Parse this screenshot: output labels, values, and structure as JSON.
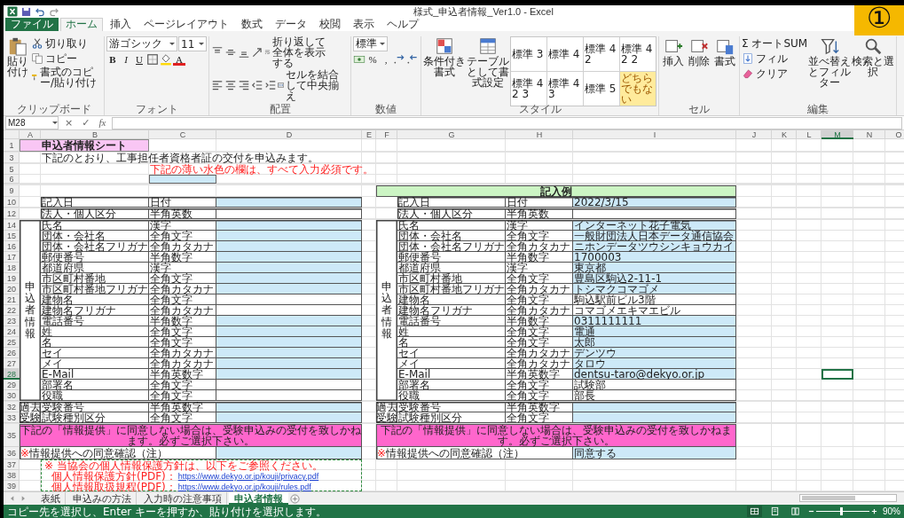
{
  "window": {
    "title": "様式_申込者情報_Ver1.0 - Excel",
    "badge": "①"
  },
  "ribbon": {
    "tabs": [
      {
        "label": "ファイル",
        "kind": "file",
        "selected": false
      },
      {
        "label": "ホーム",
        "kind": "tab",
        "selected": true
      },
      {
        "label": "挿入",
        "kind": "tab",
        "selected": false
      },
      {
        "label": "ページレイアウト",
        "kind": "tab",
        "selected": false
      },
      {
        "label": "数式",
        "kind": "tab",
        "selected": false
      },
      {
        "label": "データ",
        "kind": "tab",
        "selected": false
      },
      {
        "label": "校閲",
        "kind": "tab",
        "selected": false
      },
      {
        "label": "表示",
        "kind": "tab",
        "selected": false
      },
      {
        "label": "ヘルプ",
        "kind": "tab",
        "selected": false
      }
    ],
    "groups": [
      {
        "name": "クリップボード",
        "large": [
          {
            "kind": "paste",
            "label": "貼り付け"
          }
        ],
        "rows": [
          {
            "items": [
              {
                "kind": "cut",
                "label": "切り取り"
              }
            ]
          },
          {
            "items": [
              {
                "kind": "copy",
                "label": "コピー"
              }
            ]
          },
          {
            "items": [
              {
                "kind": "format-painter",
                "label": "書式のコピー/貼り付け"
              }
            ]
          }
        ]
      },
      {
        "name": "フォント",
        "rows": [
          {
            "items": [
              {
                "kind": "dropdown",
                "value": "游ゴシック"
              },
              {
                "kind": "dropdown",
                "value": "11"
              }
            ]
          },
          {
            "items": [
              {
                "kind": "bold",
                "label": "B"
              },
              {
                "kind": "italic",
                "label": "I"
              },
              {
                "kind": "underline",
                "label": "U"
              },
              {
                "kind": "borders"
              },
              {
                "kind": "fill-color"
              },
              {
                "kind": "font-color",
                "label": "A"
              }
            ]
          }
        ]
      },
      {
        "name": "配置",
        "rows": [
          {
            "items": [
              {
                "kind": "align-top"
              },
              {
                "kind": "align-middle"
              },
              {
                "kind": "align-bottom"
              },
              {
                "kind": "orientation"
              },
              {
                "kind": "wrap-text",
                "label": "折り返して全体を表示する"
              }
            ]
          },
          {
            "items": [
              {
                "kind": "align-left"
              },
              {
                "kind": "align-center"
              },
              {
                "kind": "align-right"
              },
              {
                "kind": "decrease-indent"
              },
              {
                "kind": "increase-indent"
              },
              {
                "kind": "merge-center",
                "label": "セルを結合して中央揃え"
              }
            ]
          }
        ]
      },
      {
        "name": "数値",
        "rows": [
          {
            "items": [
              {
                "kind": "dropdown",
                "value": "標準"
              }
            ]
          },
          {
            "items": [
              {
                "kind": "currency"
              },
              {
                "kind": "percent",
                "label": "%"
              },
              {
                "kind": "comma",
                "label": ","
              },
              {
                "kind": "increase-decimal"
              },
              {
                "kind": "decrease-decimal"
              }
            ]
          }
        ]
      },
      {
        "name": "スタイル",
        "large": [
          {
            "kind": "conditional-format",
            "label": "条件付き書式"
          },
          {
            "kind": "format-as-table",
            "label": "テーブルとして書式設定"
          }
        ],
        "gallery": [
          {
            "label": "標準 3",
            "kind": "normal"
          },
          {
            "label": "標準 4",
            "kind": "normal"
          },
          {
            "label": "標準 4 2",
            "kind": "normal"
          },
          {
            "label": "標準 4 2 2",
            "kind": "normal"
          },
          {
            "label": "標準 4 2 3",
            "kind": "normal"
          },
          {
            "label": "標準 4 3",
            "kind": "normal"
          },
          {
            "label": "標準 5",
            "kind": "normal"
          },
          {
            "label": "どちらでもない",
            "kind": "neutral"
          }
        ]
      },
      {
        "name": "セル",
        "large": [
          {
            "kind": "insert",
            "label": "挿入"
          },
          {
            "kind": "delete",
            "label": "削除"
          },
          {
            "kind": "format",
            "label": "書式"
          }
        ]
      },
      {
        "name": "編集",
        "rows": [
          {
            "items": [
              {
                "kind": "autosum",
                "label": "Σ オートSUM"
              }
            ]
          },
          {
            "items": [
              {
                "kind": "fill",
                "label": "フィル"
              }
            ]
          },
          {
            "items": [
              {
                "kind": "clear",
                "label": "クリア"
              }
            ]
          }
        ],
        "large": [
          {
            "kind": "sort-filter",
            "label": "並べ替えとフィルター"
          },
          {
            "kind": "find-select",
            "label": "検索と選択"
          }
        ]
      }
    ]
  },
  "formula_bar": {
    "name_box": "M28",
    "cancel": "×",
    "enter": "✓",
    "function": "fx"
  },
  "sheet": {
    "columns": [
      {
        "label": "A",
        "selected": false
      },
      {
        "label": "B",
        "selected": false
      },
      {
        "label": "C",
        "selected": false
      },
      {
        "label": "D",
        "selected": false
      },
      {
        "label": "E",
        "selected": false
      },
      {
        "label": "F",
        "selected": false
      },
      {
        "label": "G",
        "selected": false
      },
      {
        "label": "H",
        "selected": false
      },
      {
        "label": "I",
        "selected": false
      },
      {
        "label": "J",
        "selected": false
      },
      {
        "label": "K",
        "selected": false
      },
      {
        "label": "L",
        "selected": false
      },
      {
        "label": "M",
        "selected": true
      },
      {
        "label": "N",
        "selected": false
      },
      {
        "label": "O",
        "selected": false
      }
    ],
    "rows": [
      {
        "kind": "title",
        "number": "1",
        "selected": false,
        "text": "申込者情報シート"
      },
      {
        "kind": "blank"
      },
      {
        "kind": "intro",
        "number": "3",
        "selected": false,
        "text": "下記のとおり、工事担任者資格者証の交付を申込みます。"
      },
      {
        "kind": "blank"
      },
      {
        "kind": "warning",
        "number": "5",
        "selected": false,
        "text": "下記の薄い水色の欄は、すべて入力必須です。"
      },
      {
        "kind": "legend",
        "number": "6",
        "selected": false
      },
      {
        "kind": "blank"
      },
      {
        "kind": "blank"
      },
      {
        "kind": "example_header",
        "number": "9",
        "selected": false,
        "example_title": "記入例"
      },
      {
        "kind": "section",
        "rows": [
          {
            "number": "10",
            "selected": false,
            "left": {
              "label": "記入日",
              "type": "日付",
              "required": true
            },
            "right": {
              "label": "記入日",
              "type": "日付",
              "value": "2022/3/15",
              "required": true
            }
          }
        ]
      },
      {
        "kind": "blank"
      },
      {
        "kind": "section",
        "rows": [
          {
            "number": "12",
            "selected": false,
            "left": {
              "label": "法人・個人区分",
              "type": "半角英数",
              "required": false
            },
            "right": {
              "label": "法人・個人区分",
              "type": "半角英数",
              "required": false
            }
          }
        ]
      },
      {
        "kind": "blank"
      },
      {
        "kind": "section",
        "side_left": "申込者情報",
        "side_right": "申込者情報",
        "rows": [
          {
            "number": "14",
            "selected": false,
            "left": {
              "label": "氏名",
              "type": "漢字",
              "required": true
            },
            "right": {
              "label": "氏名",
              "type": "漢字",
              "value": "インターネット花子電気",
              "required": true
            }
          },
          {
            "number": "15",
            "selected": false,
            "left": {
              "label": "団体・会社名",
              "type": "全角文字",
              "required": true
            },
            "right": {
              "label": "団体・会社名",
              "type": "全角文字",
              "value": "一般財団法人日本データ通信協会",
              "required": true
            }
          },
          {
            "number": "16",
            "selected": false,
            "left": {
              "label": "団体・会社名フリガナ",
              "type": "全角カタカナ",
              "required": true
            },
            "right": {
              "label": "団体・会社名フリガナ",
              "type": "全角カタカナ",
              "value": "ニホンデータツウシンキョウカイ",
              "required": true
            }
          },
          {
            "number": "17",
            "selected": false,
            "left": {
              "label": "郵便番号",
              "type": "半角数字",
              "required": true
            },
            "right": {
              "label": "郵便番号",
              "type": "半角数字",
              "value": "1700003",
              "required": true
            }
          },
          {
            "number": "18",
            "selected": false,
            "left": {
              "label": "都道府県",
              "type": "漢字",
              "required": true
            },
            "right": {
              "label": "都道府県",
              "type": "漢字",
              "value": "東京都",
              "required": true
            }
          },
          {
            "number": "19",
            "selected": false,
            "left": {
              "label": "市区町村番地",
              "type": "全角文字",
              "required": true
            },
            "right": {
              "label": "市区町村番地",
              "type": "全角文字",
              "value": "豊島区駒込2-11-1",
              "required": true
            }
          },
          {
            "number": "20",
            "selected": false,
            "left": {
              "label": "市区町村番地フリガナ",
              "type": "全角カタカナ",
              "required": true
            },
            "right": {
              "label": "市区町村番地フリガナ",
              "type": "全角カタカナ",
              "value": "トシマクコマゴメ",
              "required": true
            }
          },
          {
            "number": "21",
            "selected": false,
            "left": {
              "label": "建物名",
              "type": "全角文字",
              "required": false
            },
            "right": {
              "label": "建物名",
              "type": "全角文字",
              "value": "駒込駅前ビル3階",
              "required": false
            }
          },
          {
            "number": "22",
            "selected": false,
            "left": {
              "label": "建物名フリガナ",
              "type": "全角カタカナ",
              "required": false
            },
            "right": {
              "label": "建物名フリガナ",
              "type": "全角カタカナ",
              "value": "コマゴメエキマエビル",
              "required": false
            }
          },
          {
            "number": "23",
            "selected": false,
            "left": {
              "label": "電話番号",
              "type": "半角数字",
              "required": true
            },
            "right": {
              "label": "電話番号",
              "type": "半角数字",
              "value": "0311111111",
              "required": true
            }
          },
          {
            "number": "24",
            "selected": false,
            "left": {
              "label": "姓",
              "type": "全角文字",
              "required": true
            },
            "right": {
              "label": "姓",
              "type": "全角文字",
              "value": "電通",
              "required": true
            }
          },
          {
            "number": "25",
            "selected": false,
            "left": {
              "label": "名",
              "type": "全角文字",
              "required": true
            },
            "right": {
              "label": "名",
              "type": "全角文字",
              "value": "太郎",
              "required": true
            }
          },
          {
            "number": "26",
            "selected": false,
            "left": {
              "label": "セイ",
              "type": "全角カタカナ",
              "required": true
            },
            "right": {
              "label": "セイ",
              "type": "全角カタカナ",
              "value": "デンツウ",
              "required": true
            }
          },
          {
            "number": "27",
            "selected": false,
            "left": {
              "label": "メイ",
              "type": "全角カタカナ",
              "required": true
            },
            "right": {
              "label": "メイ",
              "type": "全角カタカナ",
              "value": "タロウ",
              "required": true
            }
          },
          {
            "number": "28",
            "selected": true,
            "left": {
              "label": "E-Mail",
              "type": "半角英数字",
              "required": true
            },
            "right": {
              "label": "E-Mail",
              "type": "半角英数字",
              "value": "dentsu-taro@dekyo.or.jp",
              "required": true
            }
          },
          {
            "number": "29",
            "selected": false,
            "left": {
              "label": "部署名",
              "type": "全角文字",
              "required": false
            },
            "right": {
              "label": "部署名",
              "type": "全角文字",
              "value": "試験部",
              "required": false
            }
          },
          {
            "number": "30",
            "selected": false,
            "left": {
              "label": "役職",
              "type": "全角文字",
              "required": false
            },
            "right": {
              "label": "役職",
              "type": "全角文字",
              "value": "部長",
              "required": false
            }
          }
        ]
      },
      {
        "kind": "blank"
      },
      {
        "kind": "section",
        "side_left": "過去受験",
        "side_right": "過去受験",
        "rows": [
          {
            "number": "32",
            "selected": false,
            "left": {
              "label": "受験番号",
              "type": "半角英数字",
              "required": true
            },
            "right": {
              "label": "受験番号",
              "type": "半角英数字",
              "required": true
            }
          },
          {
            "number": "33",
            "selected": false,
            "left": {
              "label": "試験種別区分",
              "type": "全角文字",
              "required": true
            },
            "right": {
              "label": "試験種別区分",
              "type": "全角文字",
              "required": true
            }
          }
        ]
      },
      {
        "kind": "blank"
      },
      {
        "kind": "banner",
        "number": "35",
        "selected": false,
        "left": "下記の「情報提供」に同意しない場合は、受験申込みの受付を致しかねます。必ずご選択下さい。",
        "right": "下記の「情報提供」に同意しない場合は、受験申込みの受付を致しかねます。必ずご選択下さい。"
      },
      {
        "kind": "consent",
        "number": "36",
        "selected": false,
        "left": {
          "mark": "※",
          "label": "情報提供への同意確認（注）",
          "required": true
        },
        "right": {
          "mark": "※",
          "label": "情報提供への同意確認（注）",
          "value": "同意する",
          "required": true
        }
      },
      {
        "kind": "notes",
        "lines": [
          {
            "number": "37",
            "selected": false,
            "text": "※ 当協会の個人情報保護方針は、以下をご参照ください。"
          },
          {
            "number": "38",
            "selected": false,
            "label": "個人情報保護方針(PDF)：",
            "link": "https://www.dekyo.or.jp/kouji/privacy.pdf"
          },
          {
            "number": "39",
            "selected": false,
            "label": "個人情報取扱規程(PDF)：",
            "link": "https://www.dekyo.or.jp/kouji/rules.pdf"
          }
        ]
      }
    ]
  },
  "sheet_tabs": [
    {
      "label": "表紙",
      "selected": false
    },
    {
      "label": "申込みの方法",
      "selected": false
    },
    {
      "label": "入力時の注意事項",
      "selected": false
    },
    {
      "label": "申込者情報",
      "selected": true
    }
  ],
  "status_bar": {
    "message": "コピー先を選択し、Enter キーを押すか、貼り付けを選択します。",
    "views": [
      {
        "kind": "normal",
        "selected": true
      },
      {
        "kind": "page-layout",
        "selected": false
      },
      {
        "kind": "page-break",
        "selected": false
      }
    ],
    "zoom_slider": {
      "level": 0.45
    },
    "zoom": "90%"
  }
}
